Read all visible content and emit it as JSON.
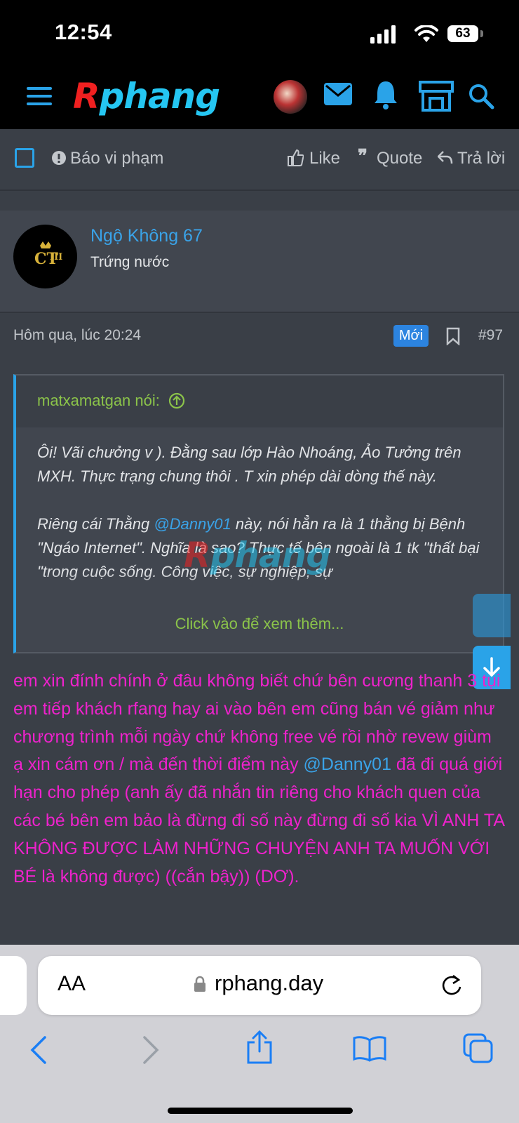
{
  "status_bar": {
    "time": "12:54",
    "battery": "63"
  },
  "header": {
    "logo_r": "R",
    "logo_rest": "phang",
    "icons": [
      "menu-icon",
      "avatar",
      "mail-icon",
      "bell-icon",
      "store-icon",
      "search-icon"
    ]
  },
  "actions": {
    "report": "Báo vi phạm",
    "like": "Like",
    "quote": "Quote",
    "reply": "Trả lời"
  },
  "user": {
    "name": "Ngộ Không 67",
    "role": "Trứng nước"
  },
  "post": {
    "time": "Hôm qua, lúc 20:24",
    "badge": "Mới",
    "number": "#97"
  },
  "quote": {
    "author": "matxamatgan nói:",
    "line1": "Ôi! Vãi chưởng v ). Đằng sau lớp Hào Nhoáng, Ảo Tưởng trên MXH. Thực trạng chung thôi . T xin phép dài dòng thế này.",
    "line2_a": "Riêng cái Thằng ",
    "line2_mention": "@Danny01",
    "line2_b": " này, nói hẳn ra là 1 thằng bị Bệnh \"Ngáo Internet\". Nghĩa là sao? Thực tế bên ngoài là 1 tk \"thất bại \"trong cuộc sống. Công việc, sự nghiệp, sự",
    "more": "Click vào để xem thêm..."
  },
  "body": {
    "part1": "em xin đính chính ở đâu không biết chứ bên cương thanh 3 tụi em tiếp khách rfang hay ai vào bên em cũng bán vé giảm như chương trình mỗi ngày chứ không free vé rồi nhờ revew giùm ạ xin cám ơn / mà đến thời điểm này ",
    "mention": "@Danny01",
    "part2": " đã đi quá giới hạn cho phép (anh ấy đã nhắn tin riêng cho khách quen của các bé bên em bảo là đừng đi số này đừng đi số kia VÌ ANH TA KHÔNG ĐƯỢC LÀM NHỮNG CHUYỆN ANH TA MUỐN VỚI BÉ là không được) ((cắn bậy)) (DƠ)."
  },
  "browser": {
    "aa": "AA",
    "url": "rphang.day"
  }
}
